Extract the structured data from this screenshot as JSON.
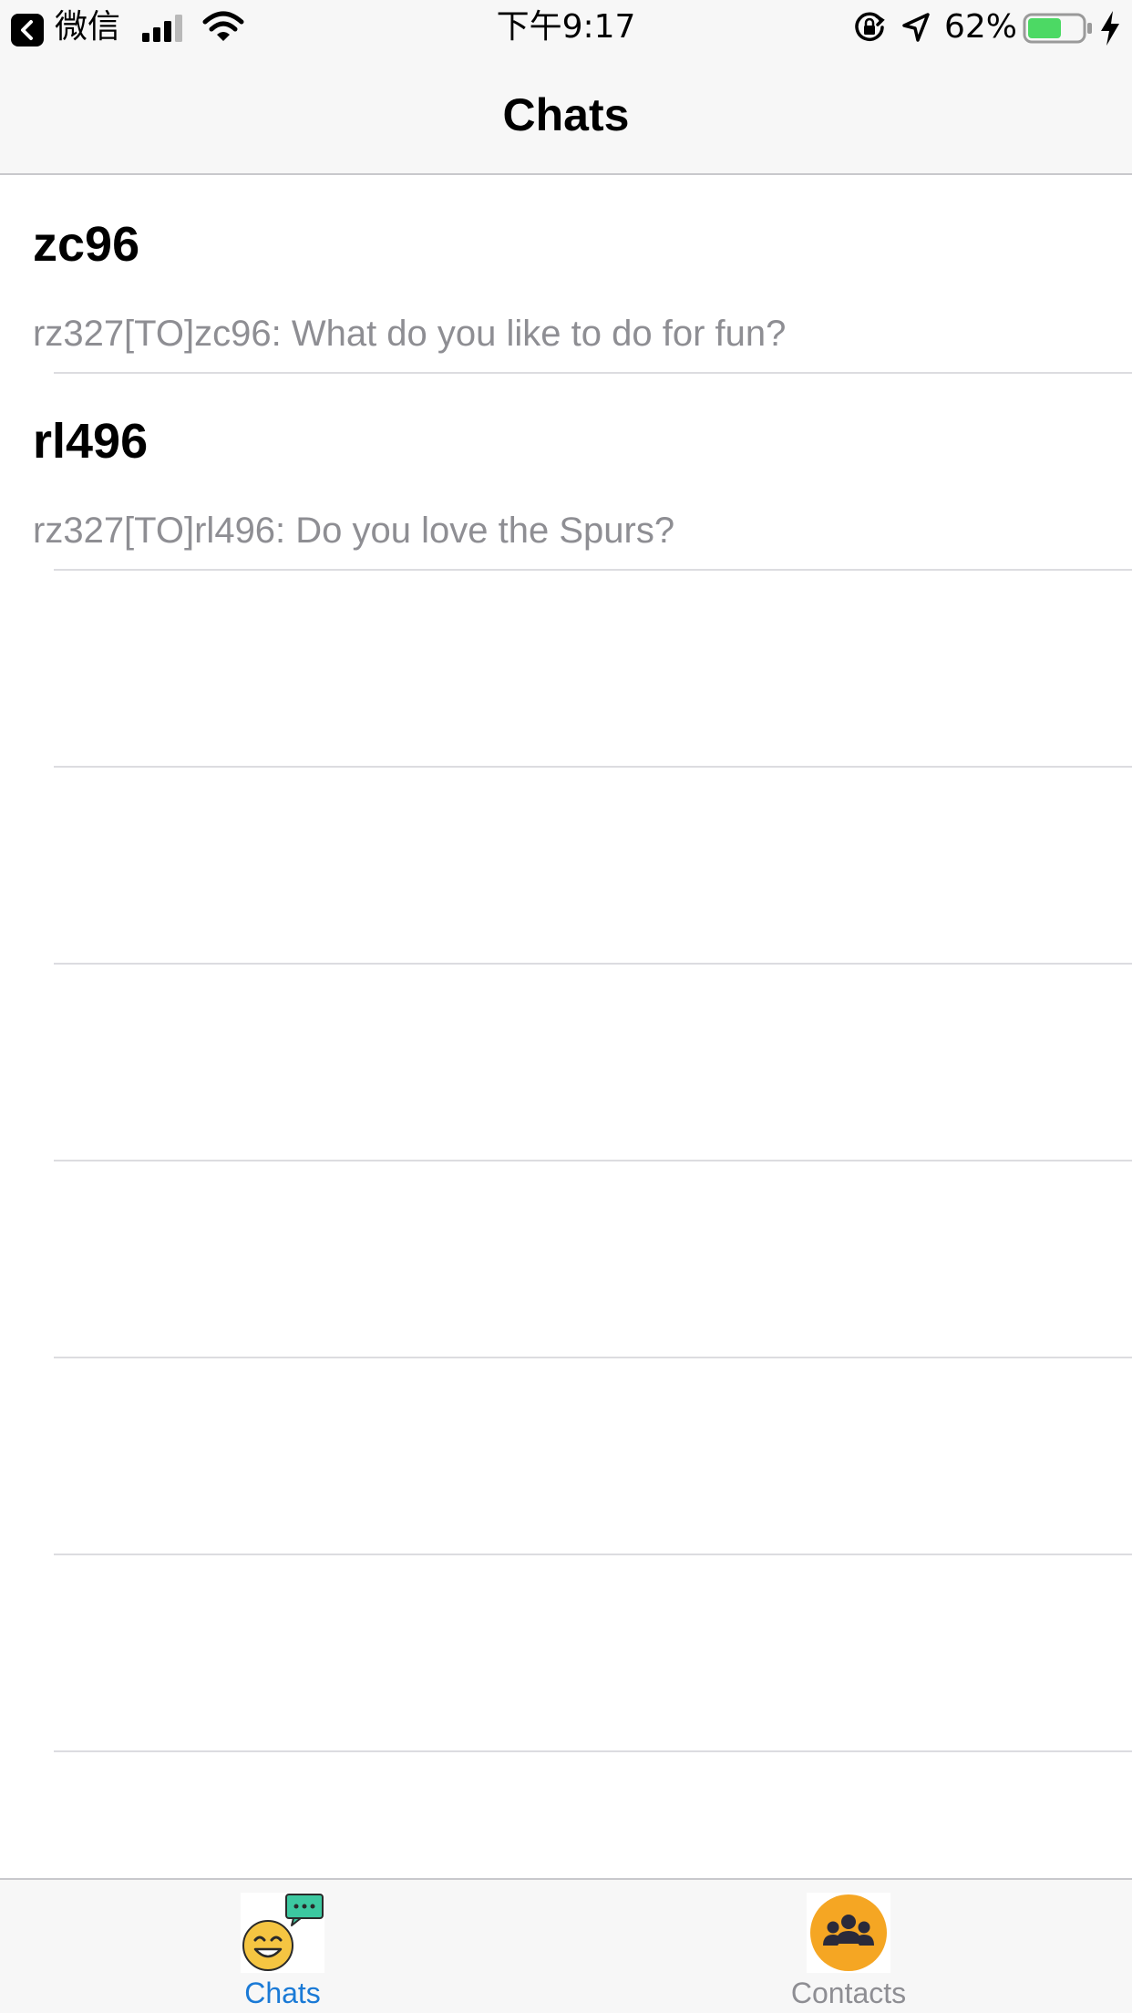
{
  "status_bar": {
    "back_label": "微信",
    "time": "下午9:17",
    "battery_percent": "62%",
    "battery_level": 0.62,
    "icons": [
      "back-chevron-icon",
      "cellular-signal-icon",
      "wifi-icon",
      "rotation-lock-icon",
      "location-arrow-icon",
      "battery-icon",
      "charging-bolt-icon"
    ]
  },
  "nav": {
    "title": "Chats"
  },
  "chats": [
    {
      "name": "zc96",
      "preview": "rz327[TO]zc96: What do you like to do for fun?"
    },
    {
      "name": "rl496",
      "preview": "rz327[TO]rl496: Do you love the Spurs?"
    }
  ],
  "tabs": [
    {
      "label": "Chats",
      "icon": "chat-smiley-icon",
      "active": true
    },
    {
      "label": "Contacts",
      "icon": "contacts-group-icon",
      "active": false
    }
  ],
  "colors": {
    "accent": "#1a7ad6",
    "contacts_icon_bg": "#f5a623",
    "chat_bubble": "#3cc8a0",
    "battery_fill": "#4cd964",
    "preview_text": "#8e8e93"
  }
}
